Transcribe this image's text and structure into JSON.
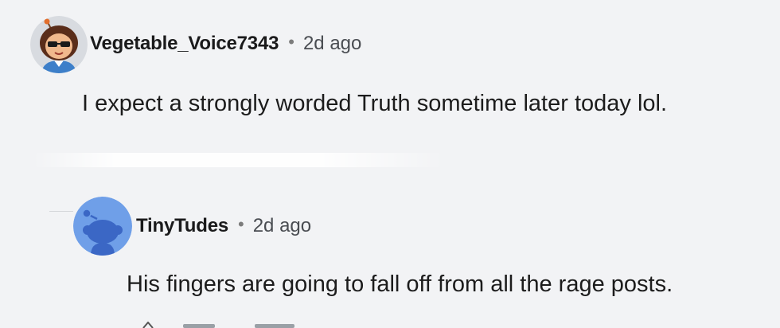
{
  "thread": {
    "comments": [
      {
        "username": "Vegetable_Voice7343",
        "separator": "•",
        "time": "2d ago",
        "text": "I expect a strongly worded Truth sometime later today lol.",
        "avatar_icon": "snoo-avatar-sunglasses-icon"
      },
      {
        "username": "TinyTudes",
        "separator": "•",
        "time": "2d ago",
        "text": "His fingers are going to fall off from all the rage posts.",
        "avatar_icon": "snoo-default-avatar-icon"
      }
    ]
  },
  "colors": {
    "background": "#f2f3f5",
    "username": "#1a1a1b",
    "timestamp": "#4a4d52",
    "body_text": "#1c1c1c",
    "default_avatar_bg": "#6f9fe8",
    "default_avatar_snoo": "#3b67c5"
  }
}
